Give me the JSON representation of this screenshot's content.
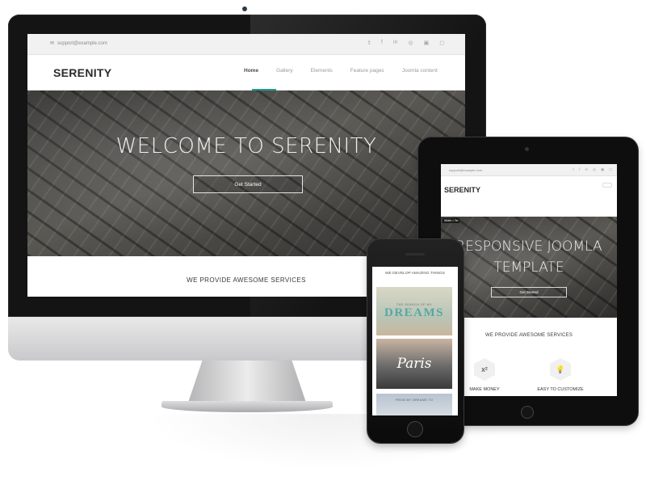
{
  "desktop": {
    "email": "support@example.com",
    "logo": "SERENITY",
    "nav": [
      "Home",
      "Gallery",
      "Elements",
      "Feature pages",
      "Joomla content"
    ],
    "active_nav": "Home",
    "social_icons": [
      "twitter-icon",
      "facebook-icon",
      "linkedin-icon",
      "dribbble-icon",
      "github-icon",
      "instagram-icon"
    ],
    "hero_title": "WELCOME TO SERENITY",
    "hero_button": "Get Started",
    "services_heading": "WE PROVIDE AWESOME SERVICES"
  },
  "tablet": {
    "email": "support@example.com",
    "logo": "SERENITY",
    "tag": "Width = Tel",
    "hero_title": "RESPONSIVE JOOMLA TEMPLATE",
    "hero_button": "Get Started",
    "services_heading": "WE PROVIDE AWESOME SERVICES",
    "features": [
      {
        "icon": "x²",
        "label": "MAKE MONEY"
      },
      {
        "icon": "lightbulb-icon",
        "label": "EASY TO CUSTOMIZE"
      }
    ]
  },
  "phone": {
    "heading": "WE DEVELOP AMAZING THINGS",
    "card1_sub": "THE SEARCH OF MY",
    "card1_title": "DREAMS",
    "card2_title": "Paris",
    "card3_text": "FROM MY DREAMS TO"
  },
  "colors": {
    "accent": "#1f9e8e",
    "text_dark": "#2b2b2b",
    "topbar_bg": "#f1f1f1"
  }
}
